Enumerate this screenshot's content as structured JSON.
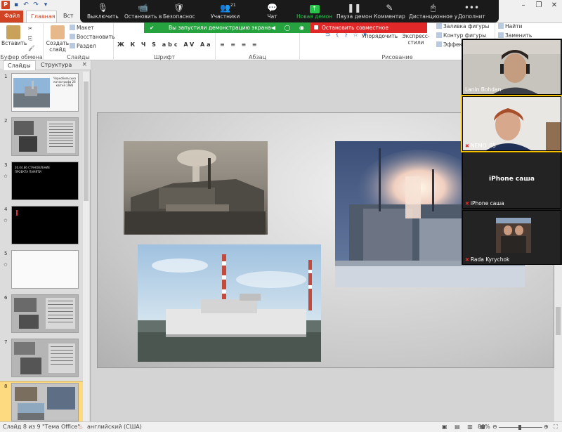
{
  "title_bar": {
    "app_icon": "P",
    "quick_access": [
      "save-icon",
      "undo-icon",
      "redo-icon",
      "dropdown-icon"
    ],
    "window_controls": [
      "–",
      "❐",
      "✕"
    ]
  },
  "ribbon_tabs": {
    "file": "Файл",
    "home": "Главная",
    "insert": "Вст"
  },
  "ribbon": {
    "clipboard": {
      "paste": "Вставить",
      "label": "Буфер обмена"
    },
    "slides": {
      "create": "Создать слайд",
      "layout": "Макет",
      "reset": "Восстановить",
      "section": "Раздел",
      "label": "Слайды"
    },
    "font": {
      "label": "Шрифт",
      "buttons": "Ж К Ч S abc AV Aa"
    },
    "paragraph": {
      "label": "Абзац"
    },
    "drawing": {
      "label": "Рисование",
      "arrange": "Упорядочить",
      "express_styles": "Экспресс-стили",
      "shape_fill": "Заливка фигуры",
      "shape_outline": "Контур фигуры",
      "effects": "Эффекты"
    },
    "editing": {
      "find": "Найти",
      "replace": "Заменить"
    }
  },
  "zoom_toolbar": {
    "items": [
      {
        "icon": "🎙",
        "label": "Выключить"
      },
      {
        "icon": "📹",
        "label": "Остановить в"
      },
      {
        "icon": "🛡",
        "label": "Безопаснос"
      },
      {
        "icon": "👥",
        "label": "Участники"
      },
      {
        "icon": "💬",
        "label": "Чат"
      },
      {
        "icon": "↑",
        "label": "Новая демон"
      },
      {
        "icon": "❚❚",
        "label": "Пауза демон"
      },
      {
        "icon": "✎",
        "label": "Комментир"
      },
      {
        "icon": "🖱",
        "label": "Дистанционное у"
      },
      {
        "icon": "•••",
        "label": "Дополнит"
      }
    ],
    "participants_count": "21",
    "sharing_message": "Вы запустили демонстрацию экрана",
    "stop_sharing": "Остановить совместное использование"
  },
  "slide_pane": {
    "tabs": [
      "Слайды",
      "Структура"
    ],
    "close": "×",
    "slides": [
      {
        "num": "1",
        "caption": "Чорнобильська катастрофа 26 квітня 1986"
      },
      {
        "num": "2"
      },
      {
        "num": "3",
        "caption": "26.04.86 СТАНОВЛЕНИЕ ПРОЕКТА ПАМЯТИ"
      },
      {
        "num": "4"
      },
      {
        "num": "5"
      },
      {
        "num": "6"
      },
      {
        "num": "7"
      },
      {
        "num": "8"
      }
    ],
    "selected": "8"
  },
  "gallery": [
    {
      "name": "Lanin Bohdan",
      "muted": false,
      "type": "video"
    },
    {
      "name": "NEMO_05",
      "muted": true,
      "type": "video",
      "active": true
    },
    {
      "name": "iPhone саша",
      "muted": true,
      "type": "name_only",
      "center_text": "iPhone саша"
    },
    {
      "name": "Rada Kyrychok",
      "muted": true,
      "type": "avatar"
    }
  ],
  "status_bar": {
    "slide_info": "Слайд 8 из 9",
    "theme": "\"Тема Office\"",
    "language": "английский (США)",
    "zoom": "80%"
  },
  "colors": {
    "accent": "#d04423",
    "zoom_green": "#26a33f",
    "zoom_red": "#e02828",
    "selected_thumb": "#fdd980"
  }
}
